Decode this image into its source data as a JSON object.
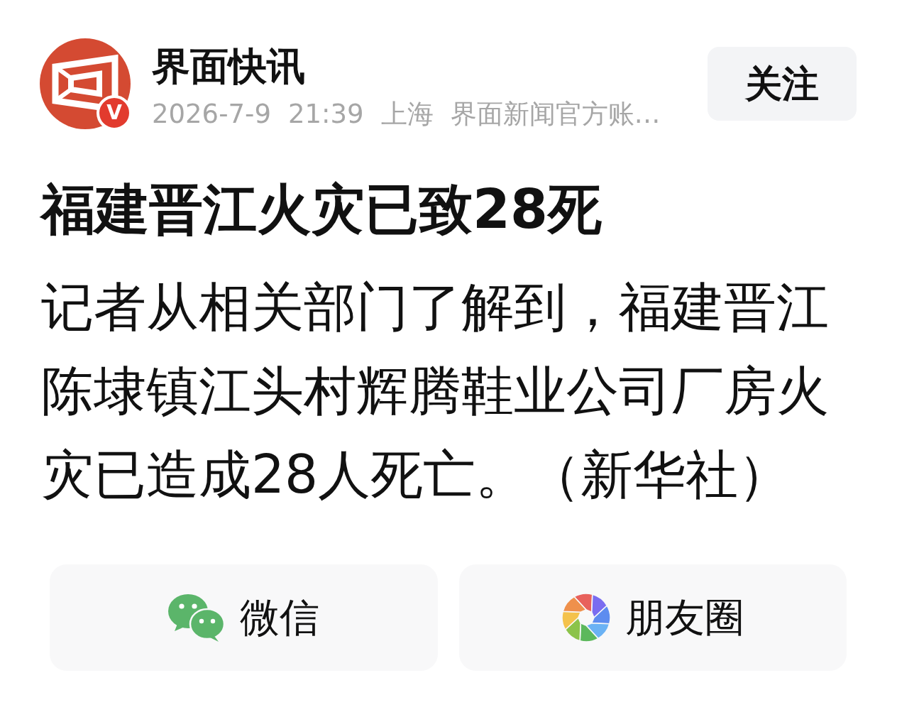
{
  "account": {
    "name": "界面快讯",
    "verified_badge": "V",
    "date": "2026-7-9",
    "time": "21:39",
    "location": "上海",
    "description": "界面新闻官方账…"
  },
  "follow_button": {
    "label": "关注"
  },
  "article": {
    "title": "福建晋江火灾已致28死",
    "body": "记者从相关部门了解到，福建晋江陈埭镇江头村辉腾鞋业公司厂房火灾已造成28人死亡。（新华社）"
  },
  "share_buttons": [
    {
      "kind": "wechat",
      "label": "微信"
    },
    {
      "kind": "moments",
      "label": "朋友圈"
    }
  ]
}
